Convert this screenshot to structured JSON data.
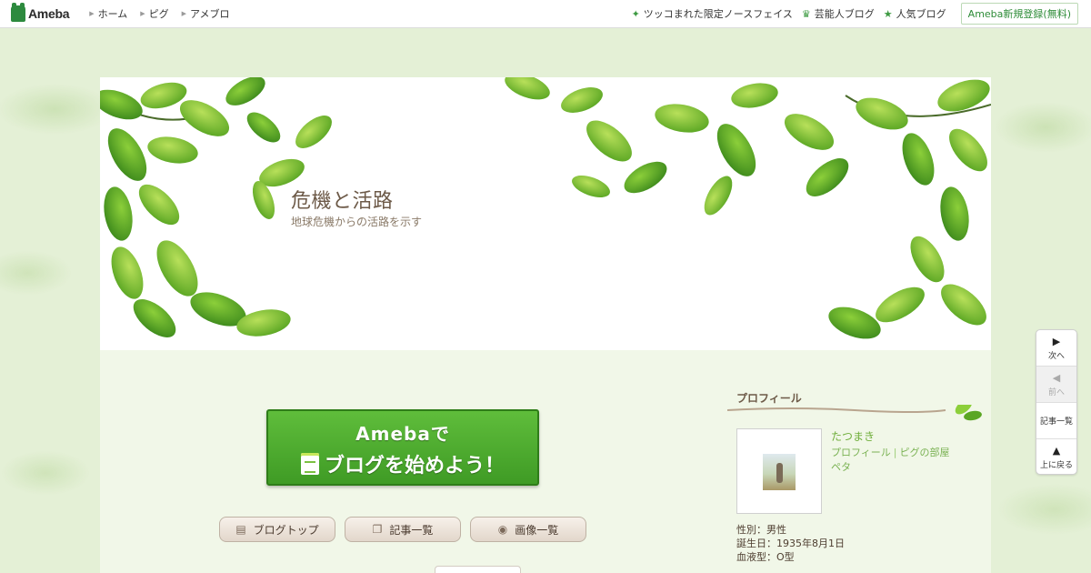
{
  "topbar": {
    "logo_text": "Ameba",
    "nav": [
      "ホーム",
      "ピグ",
      "アメブロ"
    ],
    "right": [
      {
        "label": "ツッコまれた限定ノースフェイス",
        "icon": "sparkle-icon"
      },
      {
        "label": "芸能人ブログ",
        "icon": "crown-icon"
      },
      {
        "label": "人気ブログ",
        "icon": "star-icon"
      }
    ],
    "signup_label": "Ameba新規登録(無料)"
  },
  "blog": {
    "title": "危機と活路",
    "description": "地球危機からの活路を示す"
  },
  "start_banner": {
    "line1": "Amebaで",
    "line2": "ブログを始めよう！"
  },
  "buttons": {
    "blog_top": "ブログトップ",
    "entries": "記事一覧",
    "images": "画像一覧"
  },
  "profile": {
    "heading": "プロフィール",
    "name": "たつまき",
    "link_profile": "プロフィール",
    "link_room": "ピグの部屋",
    "link_peta": "ペタ",
    "gender": "性別：男性",
    "birthday": "誕生日：1935年8月1日",
    "blood": "血液型：O型"
  },
  "sidenav": {
    "next": "次へ",
    "prev": "前へ",
    "entries": "記事一覧",
    "top": "上に戻る"
  },
  "colors": {
    "accent_green": "#3f9b25",
    "title_brown": "#6d5a48",
    "link_green": "#7ab253"
  }
}
